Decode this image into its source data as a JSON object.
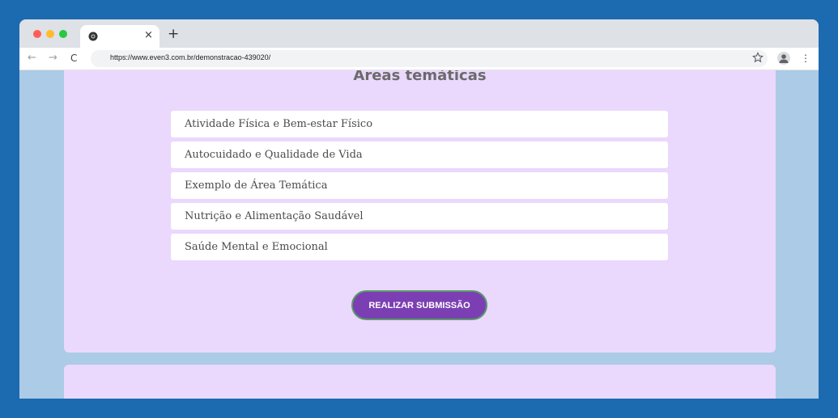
{
  "browser": {
    "url": "https://www.even3.com.br/demonstracao-439020/",
    "tab_close": "×",
    "new_tab": "+",
    "nav": {
      "back": "←",
      "forward": "→",
      "reload": "C"
    },
    "menu": "⋮"
  },
  "page": {
    "section_title": "Áreas temáticas",
    "areas": [
      "Atividade Física e Bem-estar Físico",
      "Autocuidado e Qualidade de Vida",
      "Exemplo de Área Temática",
      "Nutrição e Alimentação Saudável",
      "Saúde Mental e Emocional"
    ],
    "submit_label": "REALIZAR SUBMISSÃO"
  },
  "colors": {
    "background": "#1c6aaf",
    "card": "#ebd8fd",
    "button": "#7b3fb3",
    "button_border": "#5a9a6a"
  }
}
